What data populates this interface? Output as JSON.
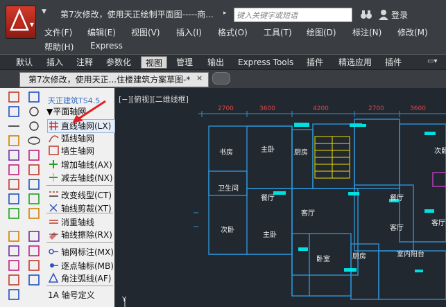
{
  "window": {
    "doc_title": "第7次修改，使用天正绘制平面图-----商...",
    "search_placeholder": "键入关键字或短语",
    "login": "登录"
  },
  "menu": {
    "row1": [
      "文件(F)",
      "编辑(E)",
      "视图(V)",
      "插入(I)",
      "格式(O)",
      "工具(T)",
      "绘图(D)",
      "标注(N)",
      "修改(M)"
    ],
    "row2": [
      "帮助(H)",
      "Express"
    ]
  },
  "ribbon": {
    "tabs": [
      "默认",
      "插入",
      "注释",
      "参数化",
      "视图",
      "管理",
      "输出",
      "Express Tools",
      "插件",
      "精选应用",
      "插件"
    ],
    "active_index": 4
  },
  "document": {
    "tab_label": "第7次修改，使用天正...住楼建筑方案草图-*",
    "close": "×"
  },
  "tianzheng": {
    "title": "天正建筑TS4.5",
    "section": "▼平面轴网",
    "items": [
      {
        "label": "直线轴网(LX)",
        "icon": "grid-icon",
        "selected": true
      },
      {
        "label": "弧线轴网",
        "icon": "arc-grid-icon"
      },
      {
        "label": "墙生轴网",
        "icon": "wall-grid-icon"
      },
      {
        "label": "增加轴线(AX)",
        "icon": "add-axis-icon"
      },
      {
        "label": "减去轴线(NX)",
        "icon": "remove-axis-icon"
      },
      {
        "label": "改变线型(CT)",
        "icon": "linetype-icon"
      },
      {
        "label": "轴线剪裁(XT)",
        "icon": "trim-axis-icon"
      },
      {
        "label": "消重轴线",
        "icon": "dedupe-axis-icon"
      },
      {
        "label": "轴线擦除(RX)",
        "icon": "erase-axis-icon"
      },
      {
        "label": "轴网标注(MX)",
        "icon": "axis-dim-icon"
      },
      {
        "label": "逐点轴标(MB)",
        "icon": "point-tag-icon"
      },
      {
        "label": "角注弧线(AF)",
        "icon": "angle-arc-icon"
      },
      {
        "label": "1A 轴号定义",
        "icon": "axis-number-icon"
      }
    ]
  },
  "drawing": {
    "view_label": "[−][俯视][二维线框]",
    "dims": [
      "2700",
      "3600",
      "4200",
      "2700",
      "3600"
    ],
    "rooms": [
      "书房",
      "主卧",
      "厨房",
      "次卧",
      "卫生间",
      "餐厅",
      "客厅",
      "餐厅",
      "客厅",
      "客厅",
      "主卧",
      "次卧",
      "卧室",
      "厨房",
      "室内阳台"
    ],
    "axis_y": "Y"
  },
  "colors": {
    "wall": "#2d93d6",
    "canvas": "#212830",
    "annotation": "#00e0e0",
    "stair": "#f0e000",
    "arrow": "#e02020"
  }
}
